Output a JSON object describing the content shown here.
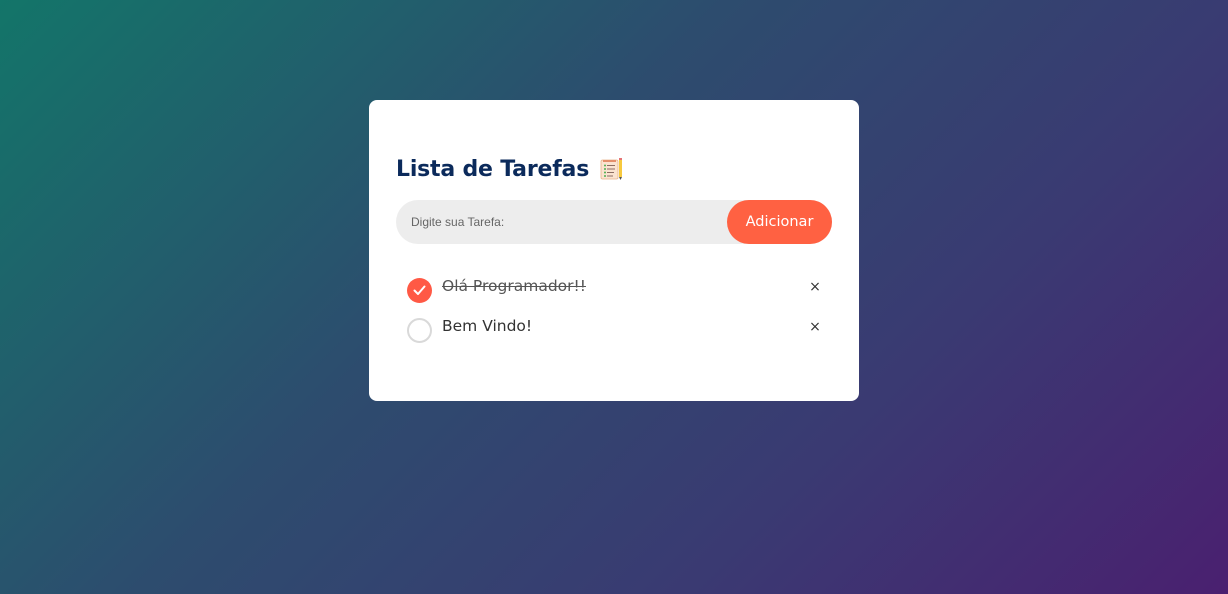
{
  "app": {
    "title": "Lista de Tarefas",
    "title_icon": "notepad-icon"
  },
  "form": {
    "input_value": "",
    "input_placeholder": "Digite sua Tarefa:",
    "add_label": "Adicionar"
  },
  "tasks": [
    {
      "text": "Olá Programador!!",
      "checked": true,
      "remove_label": "×"
    },
    {
      "text": "Bem Vindo!",
      "checked": false,
      "remove_label": "×"
    }
  ],
  "colors": {
    "accent": "#ff6142",
    "title": "#0b2a5b",
    "input_bg": "#ededed",
    "bg_gradient_start": "#137569",
    "bg_gradient_end": "#4a2070"
  }
}
